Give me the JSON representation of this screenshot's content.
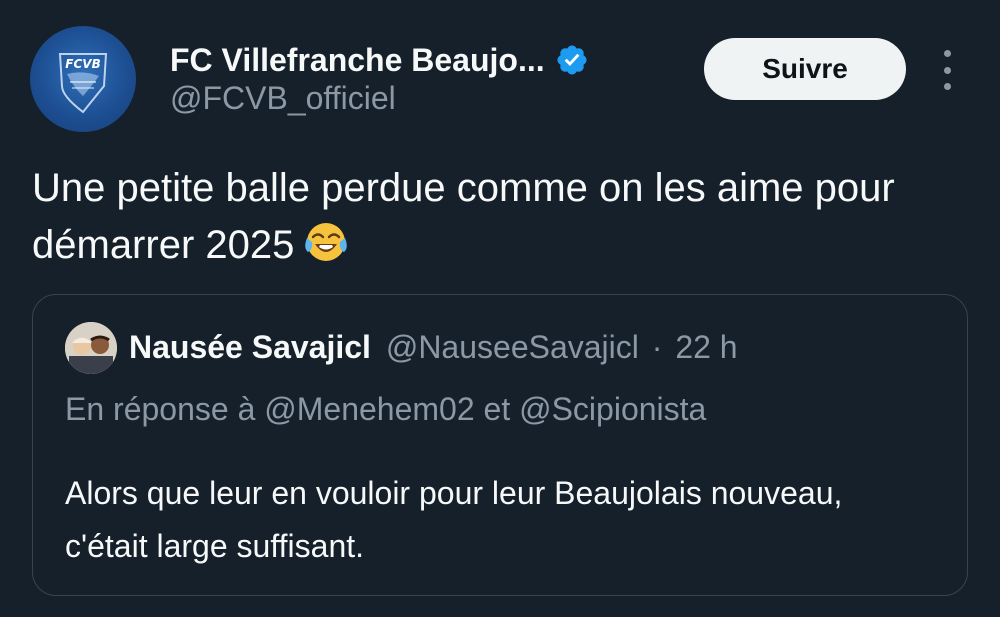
{
  "tweet": {
    "author": {
      "display_name": "FC Villefranche Beaujo...",
      "handle": "@FCVB_officiel",
      "verified": true,
      "avatar_text": "FCVB",
      "avatar_icon": "fcvb-crest-icon"
    },
    "follow_label": "Suivre",
    "more_icon": "more-vertical-icon",
    "text": "Une petite balle perdue comme on les aime pour démarrer 2025",
    "emoji": "face-with-tears-of-joy-emoji",
    "colors": {
      "background": "#15202b",
      "verified_blue": "#1d9bf0",
      "muted_text": "#8b98a5",
      "follow_button_bg": "#eff3f4"
    }
  },
  "quote": {
    "display_name": "Nausée Savajicl",
    "handle": "@NauseeSavajicl",
    "separator": "·",
    "time": "22 h",
    "reply_to": "En réponse à @Menehem02 et @Scipionista",
    "text": "Alors que leur en vouloir pour leur Beaujolais nouveau, c'était large suffisant."
  }
}
